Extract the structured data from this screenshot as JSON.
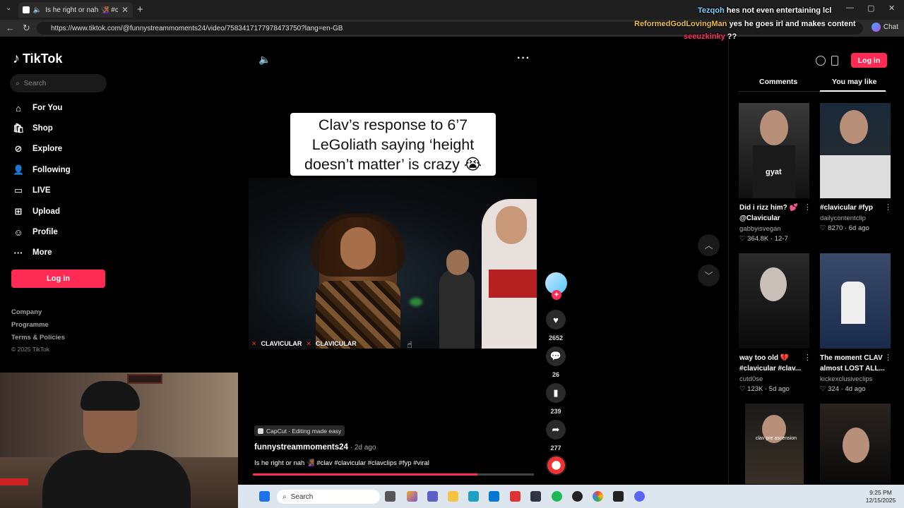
{
  "browser": {
    "tab_title": "Is he right or nah 🧏🏾‍♀️ #clav #c",
    "url": "https://www.tiktok.com/@funnystreammoments24/video/7583417177978473750?lang=en-GB",
    "chat_label": "Chat"
  },
  "sidebar": {
    "logo": "TikTok",
    "search_placeholder": "Search",
    "items": [
      {
        "label": "For You",
        "icon": "home-icon"
      },
      {
        "label": "Shop",
        "icon": "shop-icon"
      },
      {
        "label": "Explore",
        "icon": "compass-icon"
      },
      {
        "label": "Following",
        "icon": "following-icon"
      },
      {
        "label": "LIVE",
        "icon": "live-icon"
      },
      {
        "label": "Upload",
        "icon": "upload-icon"
      },
      {
        "label": "Profile",
        "icon": "profile-icon"
      },
      {
        "label": "More",
        "icon": "more-icon"
      }
    ],
    "login_label": "Log in",
    "footer": [
      "Company",
      "Programme",
      "Terms & Policies"
    ],
    "copyright": "© 2025 TikTok"
  },
  "video": {
    "caption_card": "Clav’s response to 6’7 LeGoliath saying ‘height doesn’t matter’ is crazy 😭",
    "watermark_1": "CLAVICULAR",
    "watermark_2": "CLAVICULAR",
    "capcut": "CapCut · Editing made easy",
    "author": "funnystreammoments24",
    "ago": " · 2d ago",
    "description": "Is he right or nah 🧏🏾‍♀️ #clav #clavicular #clavclips #fyp #viral",
    "progress": 0.8
  },
  "actions": {
    "likes": "2652",
    "comments": "26",
    "saves": "239",
    "shares": "277"
  },
  "right_panel": {
    "login_label": "Log in",
    "tab_comments": "Comments",
    "tab_you_may_like": "You may like",
    "thumbs": [
      {
        "title": "Did i rizz him? 💕 @Clavicular",
        "user": "gabbyisvegan",
        "stats": "♡ 364.8K · 12-7",
        "overlay": "gyat"
      },
      {
        "title": "#clavicular #fyp",
        "user": "dailycontentclip",
        "stats": "♡ 8270 · 6d ago",
        "overlay": ""
      },
      {
        "title": "way too old 💔 #clavicular #clav...",
        "user": "cutd0se",
        "stats": "♡ 123K · 5d ago",
        "overlay": ""
      },
      {
        "title": "The moment CLAV almost LOST ALL...",
        "user": "kickexclusiveclips",
        "stats": "♡ 324 · 4d ago",
        "overlay": ""
      },
      {
        "title": "",
        "user": "",
        "stats": "",
        "overlay": "clav pre ascension"
      },
      {
        "title": "",
        "user": "",
        "stats": "",
        "overlay": ""
      }
    ]
  },
  "chat_overlay": [
    {
      "user": "Tezqoh",
      "msg": "hes not even entertaining lcl",
      "color": "#7fd0ff"
    },
    {
      "user": "ReformedGodLovingMan",
      "msg": "yes he goes irl and makes content",
      "color": "#f0c040"
    },
    {
      "user": "seeuzkinky",
      "msg": "??",
      "color": "#ff3060"
    }
  ],
  "taskbar": {
    "search": "Search",
    "time": "9:25 PM",
    "date": "12/15/2025"
  }
}
